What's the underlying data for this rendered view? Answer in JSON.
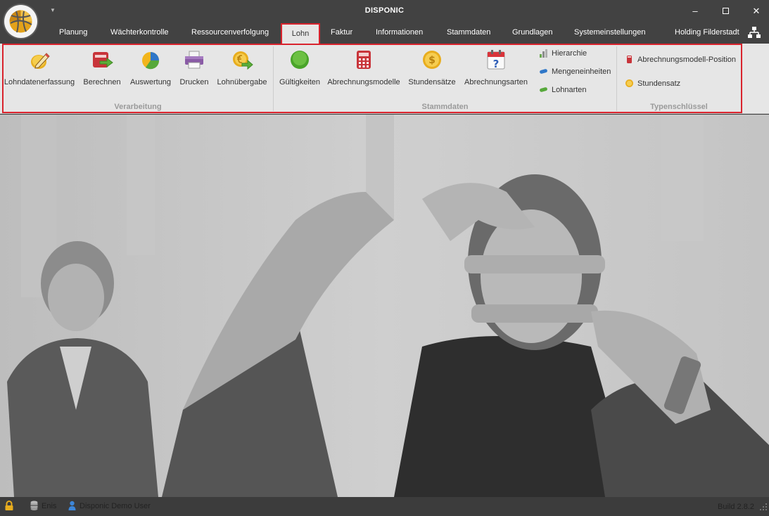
{
  "window": {
    "title": "DISPONIC",
    "minimize": "–",
    "close": "✕"
  },
  "tabs": [
    {
      "label": "Planung",
      "active": false
    },
    {
      "label": "Wächterkontrolle",
      "active": false
    },
    {
      "label": "Ressourcenverfolgung",
      "active": false
    },
    {
      "label": "Lohn",
      "active": true
    },
    {
      "label": "Faktur",
      "active": false
    },
    {
      "label": "Informationen",
      "active": false
    },
    {
      "label": "Stammdaten",
      "active": false
    },
    {
      "label": "Grundlagen",
      "active": false
    },
    {
      "label": "Systemeinstellungen",
      "active": false
    },
    {
      "label": "Holding Filderstadt",
      "active": false
    }
  ],
  "ribbon": {
    "verarbeitung": {
      "label": "Verarbeitung",
      "buttons": [
        {
          "label": "Lohndatenerfassung",
          "icon": "pencil-coin-icon"
        },
        {
          "label": "Berechnen",
          "icon": "calculate-arrow-icon"
        },
        {
          "label": "Auswertung",
          "icon": "pie-chart-icon"
        },
        {
          "label": "Drucken",
          "icon": "printer-icon"
        },
        {
          "label": "Lohnübergabe",
          "icon": "coin-transfer-icon"
        }
      ]
    },
    "stammdaten": {
      "label": "Stammdaten",
      "buttons": [
        {
          "label": "Gültigkeiten",
          "icon": "green-circle-icon"
        },
        {
          "label": "Abrechnungsmodelle",
          "icon": "calculator-icon"
        },
        {
          "label": "Stundensätze",
          "icon": "dollar-coin-icon"
        },
        {
          "label": "Abrechnungsarten",
          "icon": "calendar-question-icon"
        }
      ],
      "small_buttons": [
        {
          "label": "Hierarchie",
          "icon": "bar-chart-icon"
        },
        {
          "label": "Mengeneinheiten",
          "icon": "blue-pill-icon"
        },
        {
          "label": "Lohnarten",
          "icon": "green-pill-icon"
        }
      ]
    },
    "typenschluessel": {
      "label": "Typenschlüssel",
      "small_buttons": [
        {
          "label": "Abrechnungsmodell-Position",
          "icon": "red-cylinder-icon"
        },
        {
          "label": "Stundensatz",
          "icon": "gold-coin-icon"
        }
      ]
    }
  },
  "statusbar": {
    "db": "Enis",
    "user": "Disponic Demo User",
    "build": "Build 2.8.2"
  }
}
